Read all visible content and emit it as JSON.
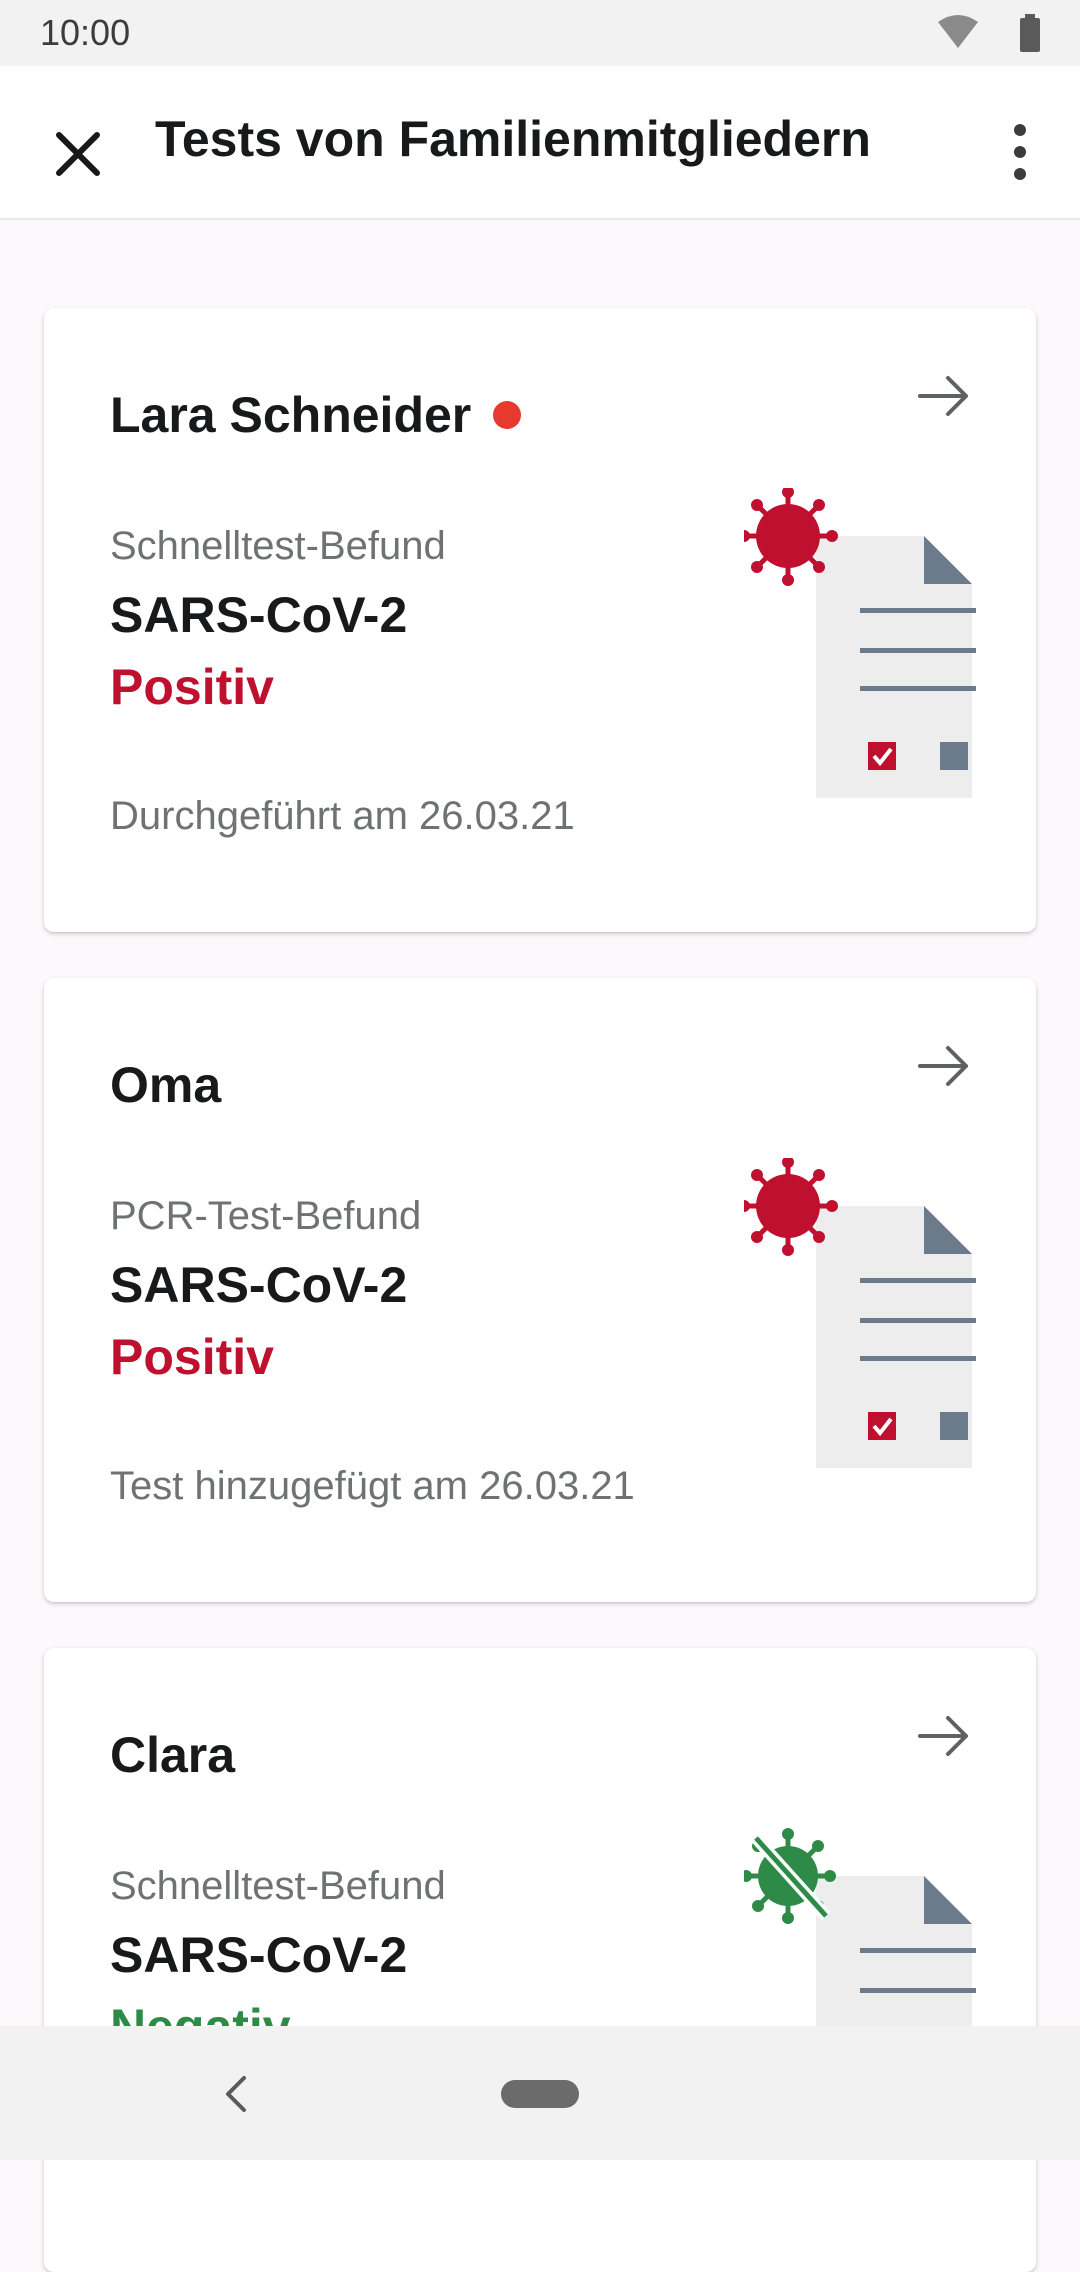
{
  "status_bar": {
    "time": "10:00",
    "icons": [
      "wifi-icon",
      "battery-icon"
    ]
  },
  "app_bar": {
    "title": "Tests von Familienmitgliedern",
    "close_icon": "close-icon",
    "menu_icon": "more-vertical-icon"
  },
  "colors": {
    "positive": "#c0102f",
    "negative": "#2e8b47",
    "new_dot": "#e8392f",
    "document_slate": "#6b7b8c"
  },
  "cards": [
    {
      "name": "Lara Schneider",
      "has_new_indicator": true,
      "test_type": "Schnelltest-Befund",
      "disease": "SARS-CoV-2",
      "result": "Positiv",
      "result_status": "positive",
      "date_text": "Durchgeführt am 26.03.21"
    },
    {
      "name": "Oma",
      "has_new_indicator": false,
      "test_type": "PCR-Test-Befund",
      "disease": "SARS-CoV-2",
      "result": "Positiv",
      "result_status": "positive",
      "date_text": "Test hinzugefügt am 26.03.21"
    },
    {
      "name": "Clara",
      "has_new_indicator": false,
      "test_type": "Schnelltest-Befund",
      "disease": "SARS-CoV-2",
      "result": "Negativ",
      "result_status": "negative",
      "date_text": ""
    }
  ],
  "nav_bar": {
    "back_icon": "back-chevron-icon",
    "home_icon": "home-pill-icon"
  }
}
